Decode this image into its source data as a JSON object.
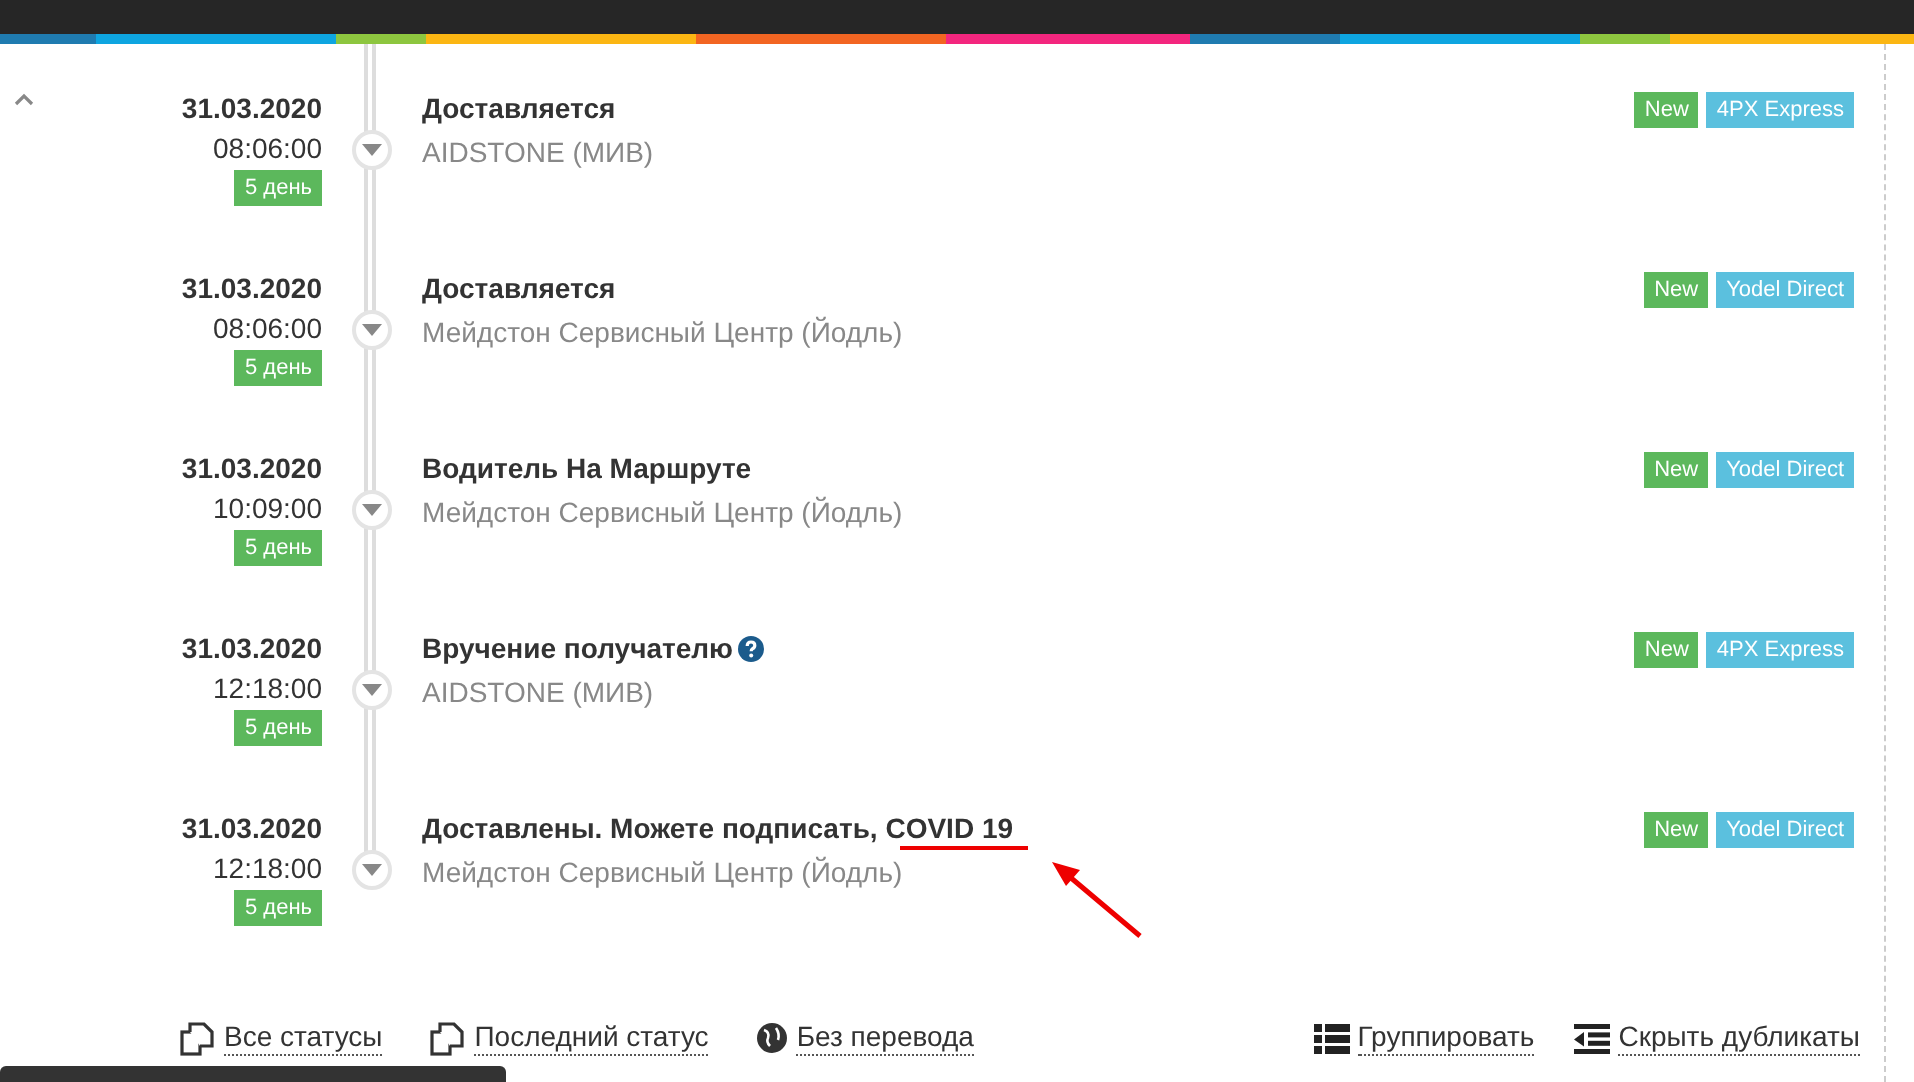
{
  "events": [
    {
      "date": "31.03.2020",
      "time": "08:06:00",
      "age": "5 день",
      "title": "Доставляется",
      "help": false,
      "annotated": false,
      "location": "AIDSTONE (МИВ)",
      "badges": [
        {
          "label": "New",
          "kind": "status"
        },
        {
          "label": "4PX Express",
          "kind": "carrier"
        }
      ]
    },
    {
      "date": "31.03.2020",
      "time": "08:06:00",
      "age": "5 день",
      "title": "Доставляется",
      "help": false,
      "annotated": false,
      "location": "Мейдстон Сервисный Центр (Йодль)",
      "badges": [
        {
          "label": "New",
          "kind": "status"
        },
        {
          "label": "Yodel Direct",
          "kind": "carrier"
        }
      ]
    },
    {
      "date": "31.03.2020",
      "time": "10:09:00",
      "age": "5 день",
      "title": "Водитель На Маршруте",
      "help": false,
      "annotated": false,
      "location": "Мейдстон Сервисный Центр (Йодль)",
      "badges": [
        {
          "label": "New",
          "kind": "status"
        },
        {
          "label": "Yodel Direct",
          "kind": "carrier"
        }
      ]
    },
    {
      "date": "31.03.2020",
      "time": "12:18:00",
      "age": "5 день",
      "title": "Вручение получателю",
      "help": true,
      "annotated": false,
      "location": "AIDSTONE (МИВ)",
      "badges": [
        {
          "label": "New",
          "kind": "status"
        },
        {
          "label": "4PX Express",
          "kind": "carrier"
        }
      ]
    },
    {
      "date": "31.03.2020",
      "time": "12:18:00",
      "age": "5 день",
      "title": "Доставлены. Можете подписать, COVID 19",
      "help": false,
      "annotated": true,
      "location": "Мейдстон Сервисный Центр (Йодль)",
      "badges": [
        {
          "label": "New",
          "kind": "status"
        },
        {
          "label": "Yodel Direct",
          "kind": "carrier"
        }
      ]
    }
  ],
  "footer_left": [
    {
      "label": "Все статусы"
    },
    {
      "label": "Последний статус"
    },
    {
      "label": "Без перевода"
    }
  ],
  "footer_right": [
    {
      "label": "Группировать"
    },
    {
      "label": "Скрыть дубликаты"
    }
  ]
}
